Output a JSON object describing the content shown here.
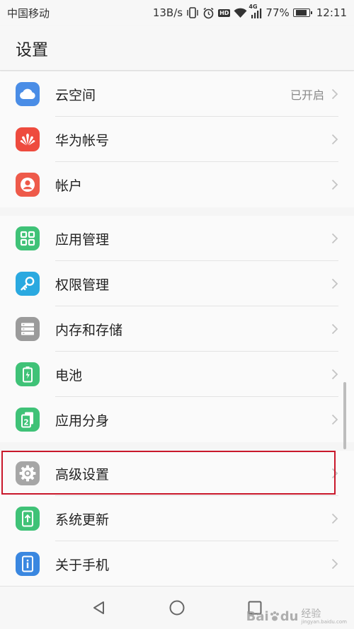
{
  "status_bar": {
    "carrier": "中国移动",
    "speed": "13B/s",
    "network_badge": "4G",
    "battery": "77%",
    "battery_level": 0.77,
    "time": "12:11",
    "icons": [
      "vibrate-icon",
      "alarm-icon",
      "hd-icon",
      "wifi-icon",
      "signal-icon",
      "battery-icon"
    ]
  },
  "header": {
    "title": "设置"
  },
  "groups": [
    {
      "items": [
        {
          "label": "云空间",
          "value": "已开启",
          "icon": "cloud-icon",
          "color": "#4a8de6"
        },
        {
          "label": "华为帐号",
          "icon": "huawei-logo-icon",
          "color": "#ee4b3e"
        },
        {
          "label": "帐户",
          "icon": "user-icon",
          "color": "#ee5a4a"
        }
      ]
    },
    {
      "items": [
        {
          "label": "应用管理",
          "icon": "apps-grid-icon",
          "color": "#3fc277"
        },
        {
          "label": "权限管理",
          "icon": "key-icon",
          "color": "#2aa9e0"
        },
        {
          "label": "内存和存储",
          "icon": "storage-icon",
          "color": "#9b9b9b"
        },
        {
          "label": "电池",
          "icon": "battery-icon",
          "color": "#3fc277"
        },
        {
          "label": "应用分身",
          "icon": "app-twin-icon",
          "color": "#3fc277"
        }
      ]
    },
    {
      "items": [
        {
          "label": "高级设置",
          "icon": "gear-icon",
          "color": "#a6a6a6",
          "highlighted": true
        },
        {
          "label": "系统更新",
          "icon": "system-update-icon",
          "color": "#3fc277"
        },
        {
          "label": "关于手机",
          "icon": "info-icon",
          "color": "#3a87e0"
        }
      ]
    }
  ],
  "navbar": {
    "buttons": [
      "back-icon",
      "home-icon",
      "recents-icon"
    ]
  },
  "watermark": {
    "brand": "Bai",
    "brand2": "du",
    "text": "经验",
    "url": "jingyan.baidu.com"
  },
  "colors": {
    "highlight_border": "#c9182b",
    "chevron": "#c4c4c4"
  }
}
